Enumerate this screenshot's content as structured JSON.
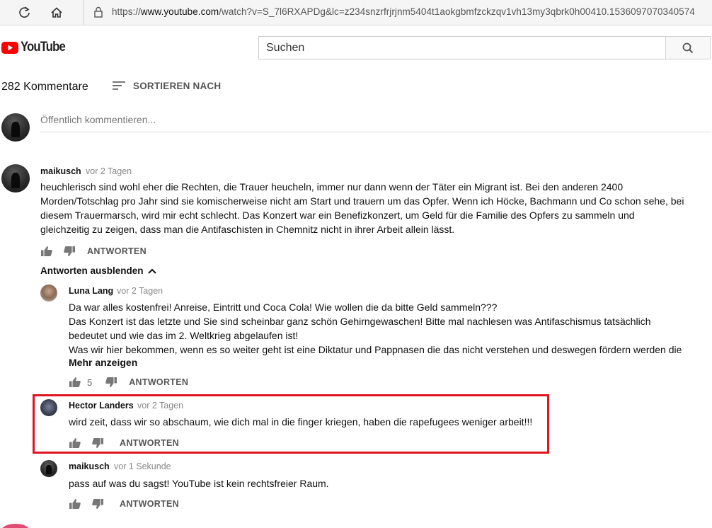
{
  "browser": {
    "url_prefix": "https://",
    "url_domain": "www.youtube.com",
    "url_rest": "/watch?v=S_7l6RXAPDg&lc=z234snzrfrjrjnm5404t1aokgbmfzckzqv1vh13my3qbrk0h00410.1536097070340574"
  },
  "header": {
    "logo_text": "YouTube",
    "search_placeholder": "Suchen"
  },
  "comments_header": {
    "count": "282 Kommentare",
    "sort_label": "SORTIEREN NACH",
    "public_placeholder": "Öffentlich kommentieren..."
  },
  "main_comment": {
    "author": "maikusch",
    "time": "vor 2 Tagen",
    "lines": [
      "heuchlerisch sind wohl eher die Rechten, die Trauer heucheln, immer nur dann wenn der Täter ein Migrant ist. Bei den anderen 2400",
      "Morden/Totschlag pro Jahr sind sie komischerweise nicht am Start und trauern um das Opfer. Wenn ich Höcke, Bachmann und Co schon sehe, bei",
      "diesem Trauermarsch, wird mir echt schlecht. Das Konzert war ein Benefizkonzert, um Geld für die Familie des Opfers zu sammeln und",
      "gleichzeitig zu zeigen, dass man die Antifaschisten in Chemnitz nicht in ihrer Arbeit allein lässt."
    ],
    "reply_label": "ANTWORTEN",
    "hide_replies_label": "Antworten ausblenden"
  },
  "replies": [
    {
      "author": "Luna Lang",
      "time": "vor 2 Tagen",
      "lines": [
        "Da war alles kostenfrei! Anreise, Eintritt und Coca Cola! Wie wollen die da bitte Geld sammeln???",
        "Das Konzert ist das letzte und Sie sind scheinbar ganz schön Gehirngewaschen! Bitte mal nachlesen was Antifaschismus tatsächlich",
        "bedeutet und wie das im 2. Weltkrieg abgelaufen ist!",
        "Was wir hier bekommen, wenn es so weiter geht ist eine Diktatur und Pappnasen die das nicht verstehen und deswegen fördern werden die"
      ],
      "more_label": "Mehr anzeigen",
      "likes": "5",
      "reply_label": "ANTWORTEN"
    },
    {
      "author": "Hector Landers",
      "time": "vor 2 Tagen",
      "lines": [
        "wird zeit, dass wir so abschaum, wie dich mal in die finger kriegen, haben die rapefugees weniger arbeit!!!"
      ],
      "reply_label": "ANTWORTEN"
    },
    {
      "author": "maikusch",
      "time": "vor 1 Sekunde",
      "lines": [
        "pass auf was du sagst! YouTube ist kein rechtsfreier Raum."
      ],
      "reply_label": "ANTWORTEN"
    }
  ],
  "colors": {
    "highlight_border": "#e0141e",
    "youtube_red": "#ff0000"
  }
}
